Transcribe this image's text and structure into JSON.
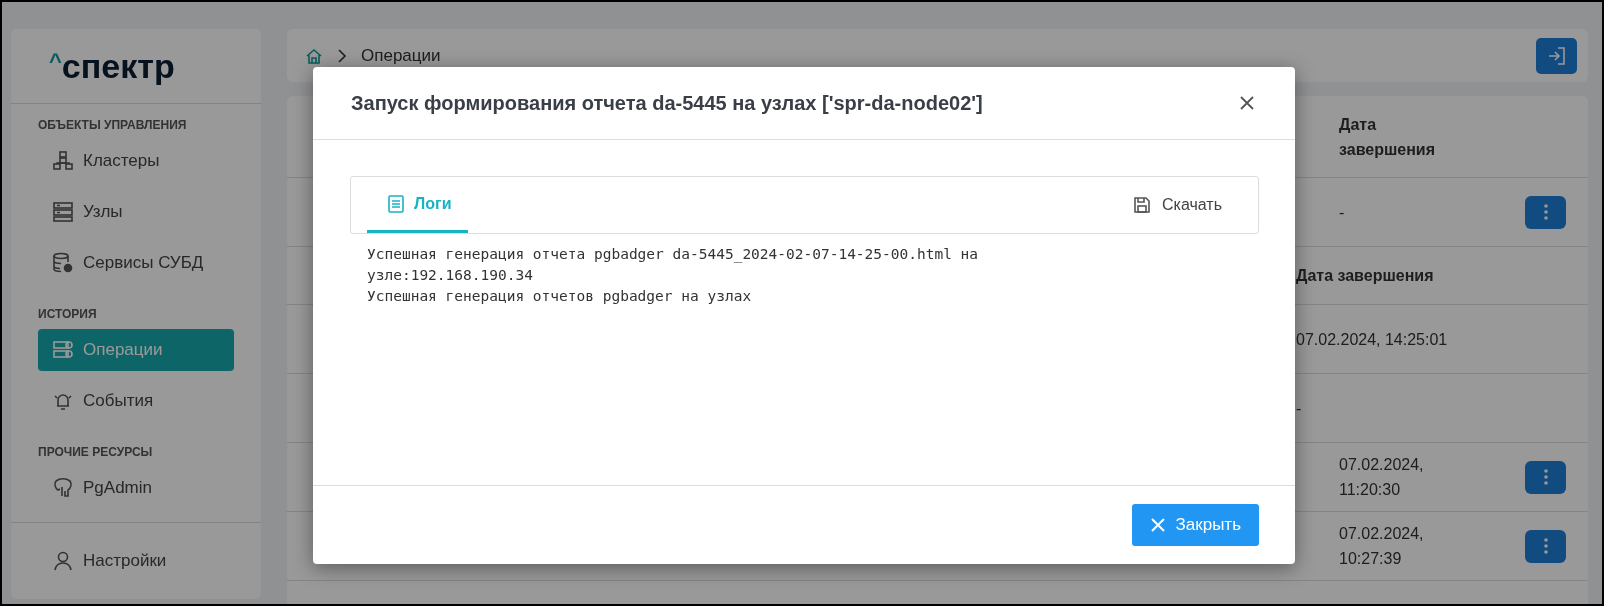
{
  "sidebar": {
    "logo": {
      "mark": "^",
      "text": "спектр"
    },
    "sections": [
      {
        "title": "ОБЪЕКТЫ УПРАВЛЕНИЯ",
        "items": [
          {
            "label": "Кластеры",
            "kind": "cluster",
            "selected": false
          },
          {
            "label": "Узлы",
            "kind": "server",
            "selected": false
          },
          {
            "label": "Сервисы СУБД",
            "kind": "database",
            "selected": false
          }
        ]
      },
      {
        "title": "ИСТОРИЯ",
        "items": [
          {
            "label": "Операции",
            "kind": "operations",
            "selected": true
          },
          {
            "label": "События",
            "kind": "bell",
            "selected": false
          }
        ]
      },
      {
        "title": "ПРОЧИЕ РЕСУРСЫ",
        "items": [
          {
            "label": "PgAdmin",
            "kind": "elephant",
            "selected": false
          }
        ]
      }
    ],
    "footer": {
      "label": "Настройки",
      "kind": "user"
    }
  },
  "breadcrumb": {
    "current": "Операции"
  },
  "table_rows": [
    {
      "kind": "header",
      "text": "Дата\nзавершения"
    },
    {
      "kind": "action",
      "text": "-"
    },
    {
      "kind": "header-plain",
      "text": "Дата завершения"
    },
    {
      "kind": "plain",
      "text": "07.02.2024, 14:25:01"
    },
    {
      "kind": "plain",
      "text": "-"
    },
    {
      "kind": "action",
      "text": "07.02.2024,\n11:20:30"
    },
    {
      "kind": "action",
      "text": "07.02.2024,\n10:27:39"
    }
  ],
  "modal": {
    "title": "Запуск формирования отчета da-5445 на узлах ['spr-da-node02']",
    "tabs": [
      {
        "label": "Логи",
        "selected": true
      }
    ],
    "download": "Скачать",
    "log_lines": [
      "Успешная генерация отчета pgbadger da-5445_2024-02-07-14-25-00.html на",
      "узле:192.168.190.34",
      "Успешная генерация отчетов pgbadger на узлах"
    ],
    "close_button": "Закрыть"
  }
}
